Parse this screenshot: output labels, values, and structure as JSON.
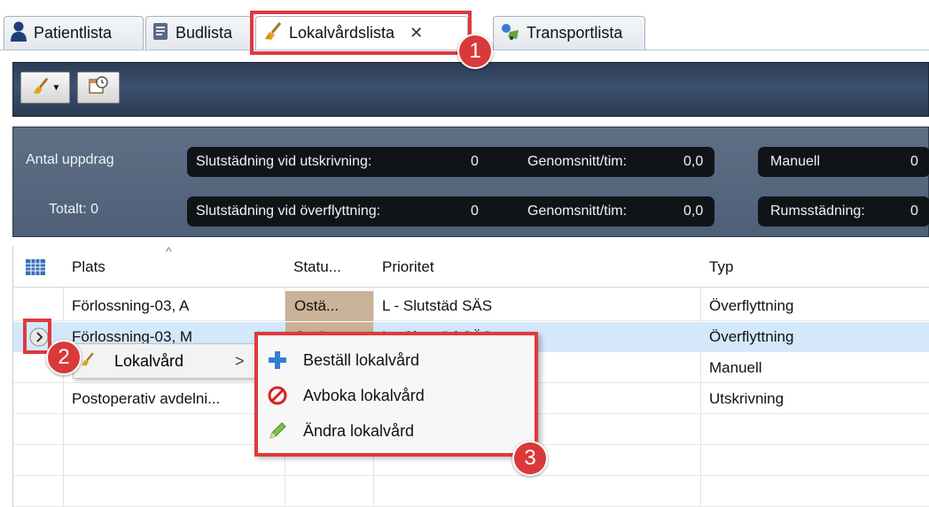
{
  "tabs": [
    {
      "label": "Patientlista",
      "icon": "person-icon"
    },
    {
      "label": "Budlista",
      "icon": "clipboard-icon"
    },
    {
      "label": "Lokalvårdslista",
      "icon": "broom-icon",
      "active": true,
      "close": "✕"
    },
    {
      "label": "Transportlista",
      "icon": "transport-icon"
    }
  ],
  "stats": {
    "antal_uppdrag": "Antal uppdrag",
    "totalt": "Totalt: 0",
    "row1": {
      "label": "Slutstädning vid utskrivning:",
      "value": "0",
      "avg_label": "Genomsnitt/tim:",
      "avg_value": "0,0",
      "right_label": "Manuell",
      "right_value": "0"
    },
    "row2": {
      "label": "Slutstädning vid överflyttning:",
      "value": "0",
      "avg_label": "Genomsnitt/tim:",
      "avg_value": "0,0",
      "right_label": "Rumsstädning:",
      "right_value": "0"
    }
  },
  "grid": {
    "columns": [
      "Plats",
      "Statu...",
      "Prioritet",
      "Typ"
    ],
    "rows": [
      {
        "plats": "Förlossning-03, A",
        "status": "Ostä...",
        "prioritet": "L - Slutstäd SÄS",
        "typ": "Överflyttning"
      },
      {
        "plats": "Förlossning-03, M",
        "status": "Ostä...",
        "prioritet": "L - Slutstäd SÄS",
        "typ": "Överflyttning"
      },
      {
        "plats": "",
        "status": "",
        "prioritet": "",
        "typ": "Manuell"
      },
      {
        "plats": "Postoperativ avdelni...",
        "status": "",
        "prioritet": "",
        "typ": "Utskrivning"
      }
    ]
  },
  "context_menu": {
    "parent_label": "Lokalvård",
    "parent_arrow": ">",
    "items": [
      {
        "label": "Beställ lokalvård",
        "icon": "plus-icon"
      },
      {
        "label": "Avboka lokalvård",
        "icon": "cancel-icon"
      },
      {
        "label": "Ändra lokalvård",
        "icon": "pencil-icon"
      }
    ]
  },
  "callouts": [
    "1",
    "2",
    "3"
  ],
  "colors": {
    "highlight": "#e0393d",
    "status_cell": "#c9b297",
    "selected_row": "#d4e8fb"
  }
}
